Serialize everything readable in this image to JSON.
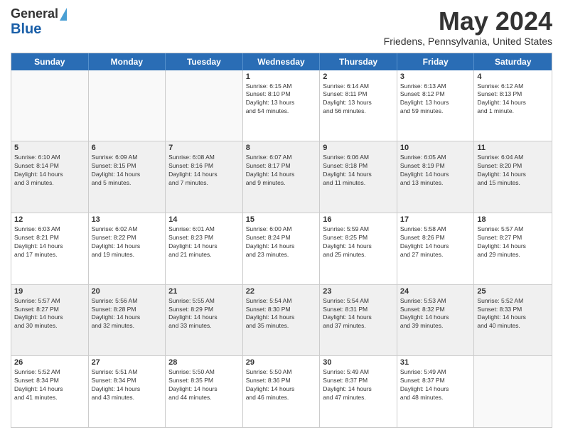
{
  "header": {
    "logo_line1": "General",
    "logo_line2": "Blue",
    "month": "May 2024",
    "location": "Friedens, Pennsylvania, United States"
  },
  "days_of_week": [
    "Sunday",
    "Monday",
    "Tuesday",
    "Wednesday",
    "Thursday",
    "Friday",
    "Saturday"
  ],
  "weeks": [
    [
      {
        "num": "",
        "lines": [],
        "empty": true
      },
      {
        "num": "",
        "lines": [],
        "empty": true
      },
      {
        "num": "",
        "lines": [],
        "empty": true
      },
      {
        "num": "1",
        "lines": [
          "Sunrise: 6:15 AM",
          "Sunset: 8:10 PM",
          "Daylight: 13 hours",
          "and 54 minutes."
        ]
      },
      {
        "num": "2",
        "lines": [
          "Sunrise: 6:14 AM",
          "Sunset: 8:11 PM",
          "Daylight: 13 hours",
          "and 56 minutes."
        ]
      },
      {
        "num": "3",
        "lines": [
          "Sunrise: 6:13 AM",
          "Sunset: 8:12 PM",
          "Daylight: 13 hours",
          "and 59 minutes."
        ]
      },
      {
        "num": "4",
        "lines": [
          "Sunrise: 6:12 AM",
          "Sunset: 8:13 PM",
          "Daylight: 14 hours",
          "and 1 minute."
        ]
      }
    ],
    [
      {
        "num": "5",
        "lines": [
          "Sunrise: 6:10 AM",
          "Sunset: 8:14 PM",
          "Daylight: 14 hours",
          "and 3 minutes."
        ],
        "shaded": true
      },
      {
        "num": "6",
        "lines": [
          "Sunrise: 6:09 AM",
          "Sunset: 8:15 PM",
          "Daylight: 14 hours",
          "and 5 minutes."
        ],
        "shaded": true
      },
      {
        "num": "7",
        "lines": [
          "Sunrise: 6:08 AM",
          "Sunset: 8:16 PM",
          "Daylight: 14 hours",
          "and 7 minutes."
        ],
        "shaded": true
      },
      {
        "num": "8",
        "lines": [
          "Sunrise: 6:07 AM",
          "Sunset: 8:17 PM",
          "Daylight: 14 hours",
          "and 9 minutes."
        ],
        "shaded": true
      },
      {
        "num": "9",
        "lines": [
          "Sunrise: 6:06 AM",
          "Sunset: 8:18 PM",
          "Daylight: 14 hours",
          "and 11 minutes."
        ],
        "shaded": true
      },
      {
        "num": "10",
        "lines": [
          "Sunrise: 6:05 AM",
          "Sunset: 8:19 PM",
          "Daylight: 14 hours",
          "and 13 minutes."
        ],
        "shaded": true
      },
      {
        "num": "11",
        "lines": [
          "Sunrise: 6:04 AM",
          "Sunset: 8:20 PM",
          "Daylight: 14 hours",
          "and 15 minutes."
        ],
        "shaded": true
      }
    ],
    [
      {
        "num": "12",
        "lines": [
          "Sunrise: 6:03 AM",
          "Sunset: 8:21 PM",
          "Daylight: 14 hours",
          "and 17 minutes."
        ]
      },
      {
        "num": "13",
        "lines": [
          "Sunrise: 6:02 AM",
          "Sunset: 8:22 PM",
          "Daylight: 14 hours",
          "and 19 minutes."
        ]
      },
      {
        "num": "14",
        "lines": [
          "Sunrise: 6:01 AM",
          "Sunset: 8:23 PM",
          "Daylight: 14 hours",
          "and 21 minutes."
        ]
      },
      {
        "num": "15",
        "lines": [
          "Sunrise: 6:00 AM",
          "Sunset: 8:24 PM",
          "Daylight: 14 hours",
          "and 23 minutes."
        ]
      },
      {
        "num": "16",
        "lines": [
          "Sunrise: 5:59 AM",
          "Sunset: 8:25 PM",
          "Daylight: 14 hours",
          "and 25 minutes."
        ]
      },
      {
        "num": "17",
        "lines": [
          "Sunrise: 5:58 AM",
          "Sunset: 8:26 PM",
          "Daylight: 14 hours",
          "and 27 minutes."
        ]
      },
      {
        "num": "18",
        "lines": [
          "Sunrise: 5:57 AM",
          "Sunset: 8:27 PM",
          "Daylight: 14 hours",
          "and 29 minutes."
        ]
      }
    ],
    [
      {
        "num": "19",
        "lines": [
          "Sunrise: 5:57 AM",
          "Sunset: 8:27 PM",
          "Daylight: 14 hours",
          "and 30 minutes."
        ],
        "shaded": true
      },
      {
        "num": "20",
        "lines": [
          "Sunrise: 5:56 AM",
          "Sunset: 8:28 PM",
          "Daylight: 14 hours",
          "and 32 minutes."
        ],
        "shaded": true
      },
      {
        "num": "21",
        "lines": [
          "Sunrise: 5:55 AM",
          "Sunset: 8:29 PM",
          "Daylight: 14 hours",
          "and 33 minutes."
        ],
        "shaded": true
      },
      {
        "num": "22",
        "lines": [
          "Sunrise: 5:54 AM",
          "Sunset: 8:30 PM",
          "Daylight: 14 hours",
          "and 35 minutes."
        ],
        "shaded": true
      },
      {
        "num": "23",
        "lines": [
          "Sunrise: 5:54 AM",
          "Sunset: 8:31 PM",
          "Daylight: 14 hours",
          "and 37 minutes."
        ],
        "shaded": true
      },
      {
        "num": "24",
        "lines": [
          "Sunrise: 5:53 AM",
          "Sunset: 8:32 PM",
          "Daylight: 14 hours",
          "and 39 minutes."
        ],
        "shaded": true
      },
      {
        "num": "25",
        "lines": [
          "Sunrise: 5:52 AM",
          "Sunset: 8:33 PM",
          "Daylight: 14 hours",
          "and 40 minutes."
        ],
        "shaded": true
      }
    ],
    [
      {
        "num": "26",
        "lines": [
          "Sunrise: 5:52 AM",
          "Sunset: 8:34 PM",
          "Daylight: 14 hours",
          "and 41 minutes."
        ]
      },
      {
        "num": "27",
        "lines": [
          "Sunrise: 5:51 AM",
          "Sunset: 8:34 PM",
          "Daylight: 14 hours",
          "and 43 minutes."
        ]
      },
      {
        "num": "28",
        "lines": [
          "Sunrise: 5:50 AM",
          "Sunset: 8:35 PM",
          "Daylight: 14 hours",
          "and 44 minutes."
        ]
      },
      {
        "num": "29",
        "lines": [
          "Sunrise: 5:50 AM",
          "Sunset: 8:36 PM",
          "Daylight: 14 hours",
          "and 46 minutes."
        ]
      },
      {
        "num": "30",
        "lines": [
          "Sunrise: 5:49 AM",
          "Sunset: 8:37 PM",
          "Daylight: 14 hours",
          "and 47 minutes."
        ]
      },
      {
        "num": "31",
        "lines": [
          "Sunrise: 5:49 AM",
          "Sunset: 8:37 PM",
          "Daylight: 14 hours",
          "and 48 minutes."
        ]
      },
      {
        "num": "",
        "lines": [],
        "empty": true
      }
    ]
  ]
}
